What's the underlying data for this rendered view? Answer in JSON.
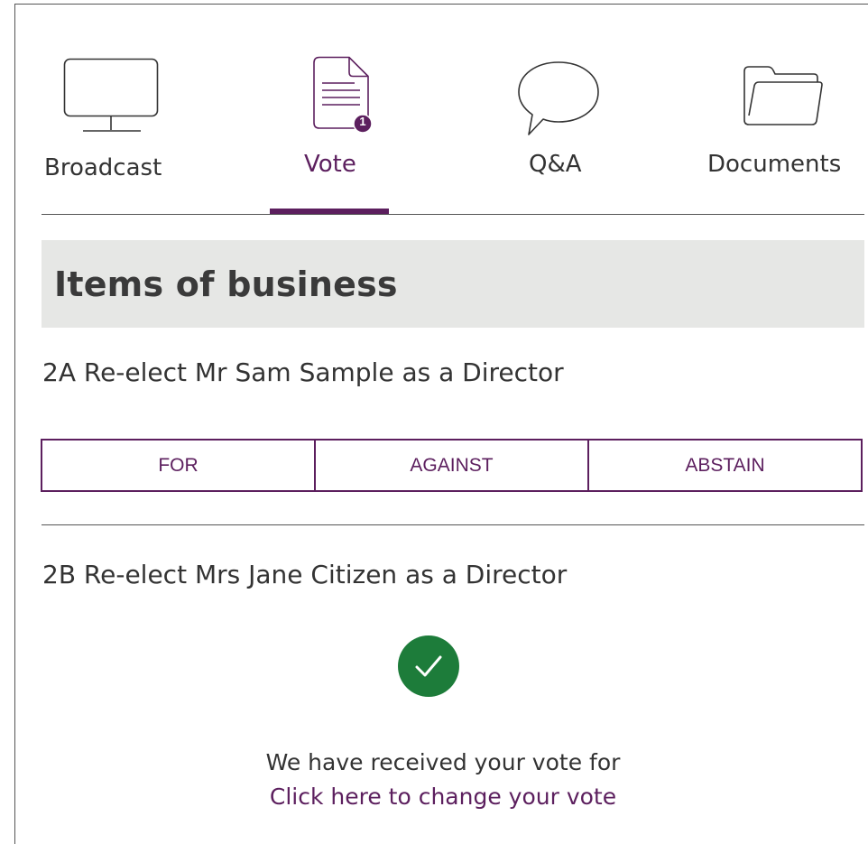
{
  "tabs": [
    {
      "label": "Broadcast",
      "icon": "monitor-icon"
    },
    {
      "label": "Vote",
      "icon": "document-icon",
      "badge": "1",
      "active": true
    },
    {
      "label": "Q&A",
      "icon": "speech-bubble-icon"
    },
    {
      "label": "Documents",
      "icon": "folder-icon"
    }
  ],
  "section": {
    "title": "Items of business"
  },
  "items": [
    {
      "title": "2A Re-elect Mr Sam Sample as a Director",
      "options": [
        "FOR",
        "AGAINST",
        "ABSTAIN"
      ]
    },
    {
      "title": "2B Re-elect Mrs Jane Citizen as a Director",
      "status_icon": "checkmark-icon",
      "received_message": "We have received your vote for",
      "change_link": "Click here to change your vote"
    }
  ],
  "colors": {
    "accent": "#5c1f5e",
    "success": "#1d7c3a",
    "header_bg": "#e6e7e5"
  }
}
